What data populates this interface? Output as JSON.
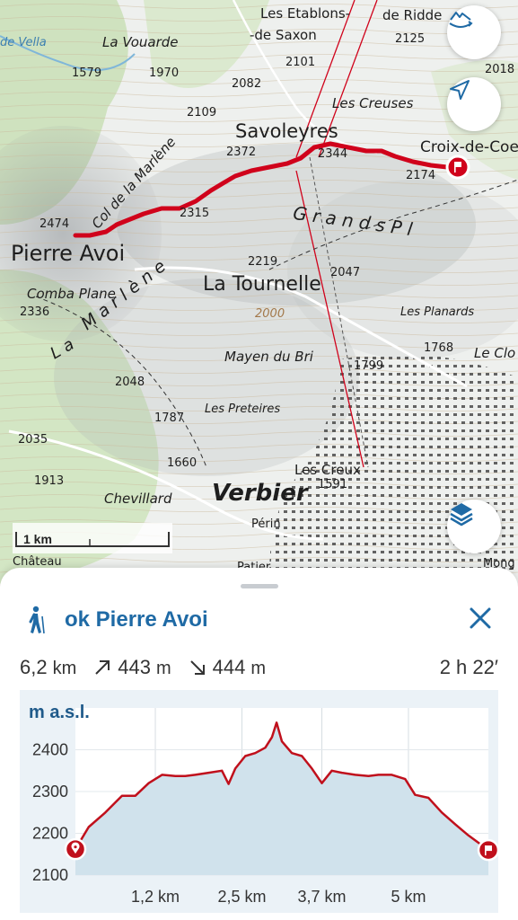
{
  "map": {
    "labels": {
      "etablons": "Les Etablons-",
      "ridde": "de Ridde",
      "saxon": "-de Saxon",
      "n2125": "2125",
      "vella": "de Vella",
      "vouarde": "La Vouarde",
      "n1579": "1579",
      "n1970": "1970",
      "n2082": "2082",
      "n2101": "2101",
      "n2018": "2018",
      "n2109": "2109",
      "creuses": "Les Creuses",
      "savoleyres": "Savoleyres",
      "croix": "Croix-de-Coe",
      "n2372": "2372",
      "n2344": "2344",
      "n2174": "2174",
      "col": "Col de la Marlène",
      "n2315": "2315",
      "n2474": "2474",
      "pierreavoi": "Pierre Avoi",
      "grands": "G r a n d s   P l",
      "n2219": "2219",
      "n2047": "2047",
      "latournelle": "La Tournelle",
      "marlene": "M a r l è n e",
      "combaplane": "Comba Plane",
      "n2336": "2336",
      "n2000": "2000",
      "planards": "Les Planards",
      "mayen": "Mayen du Bri",
      "n1768": "1768",
      "lecl": "Le Clo",
      "n1799": "1799",
      "la": "L a",
      "n2048": "2048",
      "n1787": "1787",
      "preteires": "Les Preteires",
      "n2035": "2035",
      "n1660": "1660",
      "lescreux": "Les Creux",
      "n1591": "1591",
      "n1913": "1913",
      "chevillard": "Chevillard",
      "verbier": "Verbier",
      "perin": "Périn",
      "chateau": "Château",
      "patier": "Patier",
      "mong": "Mong"
    },
    "scale_label": "1 km",
    "route_color": "#d0021b"
  },
  "buttons": {
    "rotate": "rotate-3d-icon",
    "locate": "navigation-arrow-icon",
    "layers": "layers-icon"
  },
  "sheet": {
    "title": "ok Pierre Avoi",
    "hiker_icon": "hiker-icon",
    "close_icon": "close-icon",
    "distance": "6,2",
    "distance_unit": "km",
    "ascent": "443",
    "ascent_unit": "m",
    "descent": "444",
    "descent_unit": "m",
    "duration": "2 h 22′"
  },
  "chart_data": {
    "type": "area",
    "ylabel": "m a.s.l.",
    "xlabel": "",
    "ylim": [
      2100,
      2500
    ],
    "xlim": [
      0,
      6.2
    ],
    "yticks": [
      2100,
      2200,
      2300,
      2400
    ],
    "xticks": [
      1.2,
      2.5,
      3.7,
      5
    ],
    "xtick_labels": [
      "1,2 km",
      "2,5 km",
      "3,7 km",
      "5 km"
    ],
    "grid": true,
    "x": [
      0,
      0.2,
      0.45,
      0.7,
      0.9,
      1.1,
      1.3,
      1.5,
      1.65,
      1.8,
      2.0,
      2.2,
      2.3,
      2.4,
      2.55,
      2.7,
      2.85,
      2.95,
      3.02,
      3.1,
      3.25,
      3.4,
      3.55,
      3.7,
      3.85,
      4.0,
      4.2,
      4.4,
      4.55,
      4.75,
      4.95,
      5.1,
      5.3,
      5.5,
      5.7,
      5.9,
      6.2
    ],
    "values": [
      2162,
      2215,
      2250,
      2290,
      2290,
      2320,
      2340,
      2337,
      2337,
      2340,
      2345,
      2350,
      2318,
      2355,
      2385,
      2392,
      2405,
      2430,
      2465,
      2420,
      2392,
      2385,
      2355,
      2320,
      2350,
      2345,
      2340,
      2337,
      2340,
      2340,
      2330,
      2292,
      2285,
      2250,
      2222,
      2195,
      2160
    ],
    "start_marker": "pin-icon",
    "end_marker": "flag-icon",
    "line_color": "#c0101c",
    "fill_color": "#d0e2ec"
  }
}
